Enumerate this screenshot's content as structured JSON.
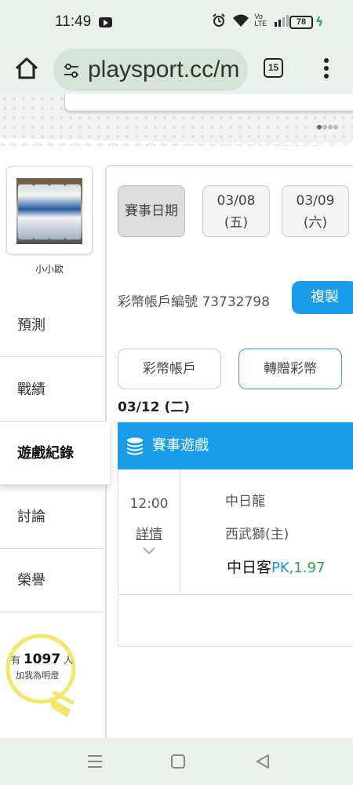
{
  "status_bar": {
    "time": "11:49",
    "signal_text": "Vo LTE",
    "battery": "78"
  },
  "browser": {
    "url": "playsport.cc/m",
    "tab_count": "15"
  },
  "sidebar": {
    "username": "小小歐",
    "items": [
      {
        "label": "預測"
      },
      {
        "label": "戰績"
      },
      {
        "label": "遊戲紀錄"
      },
      {
        "label": "討論"
      },
      {
        "label": "榮譽"
      }
    ],
    "active_index": 2,
    "bulb": {
      "prefix": "有",
      "count": "1097",
      "suffix": "人",
      "caption": "加我為明燈"
    }
  },
  "main": {
    "date_label": "賽事日期",
    "dates": [
      {
        "date": "03/08",
        "weekday": "(五)"
      },
      {
        "date": "03/09",
        "weekday": "(六)"
      }
    ],
    "account_label": "彩幣帳戶編號 73732798",
    "copy_button": "複製",
    "buttons": {
      "account": "彩幣帳戶",
      "transfer": "轉贈彩幣"
    },
    "section_date": "03/12 (二)",
    "game_section_title": "賽事遊戲",
    "game": {
      "time": "12:00",
      "detail_link": "詳情",
      "team1": "中日龍",
      "team2": "西武獅(主)",
      "pick": "中日客",
      "bet_type": "PK,",
      "odds": "1.97"
    }
  },
  "colors": {
    "accent_blue": "#1a9de8",
    "odds_green": "#2fa33a",
    "chrome_bg": "#e9f1ea"
  }
}
